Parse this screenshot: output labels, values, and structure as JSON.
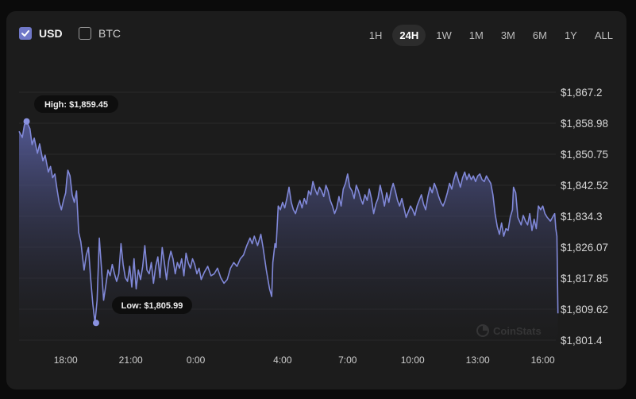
{
  "currency": {
    "usd_label": "USD",
    "btc_label": "BTC"
  },
  "ranges": [
    "1H",
    "24H",
    "1W",
    "1M",
    "3M",
    "6M",
    "1Y",
    "ALL"
  ],
  "active_range": "24H",
  "watermark": "CoinStats",
  "colors": {
    "line": "#8088d8",
    "fill_top": "#5c63a8",
    "accent": "#7078c8"
  },
  "chart_data": {
    "type": "area",
    "ylim": [
      1801.4,
      1867.2
    ],
    "y_ticks": [
      "$1,867.2",
      "$1,858.98",
      "$1,850.75",
      "$1,842.52",
      "$1,834.3",
      "$1,826.07",
      "$1,817.85",
      "$1,809.62",
      "$1,801.4"
    ],
    "x_ticks": [
      {
        "label": "18:00",
        "t": 18
      },
      {
        "label": "21:00",
        "t": 21
      },
      {
        "label": "0:00",
        "t": 24
      },
      {
        "label": "4:00",
        "t": 28
      },
      {
        "label": "7:00",
        "t": 31
      },
      {
        "label": "10:00",
        "t": 34
      },
      {
        "label": "13:00",
        "t": 37
      },
      {
        "label": "16:00",
        "t": 40
      }
    ],
    "xlim": [
      15.85,
      40.6
    ],
    "high": {
      "label": "High: $1,859.45",
      "t": 16.2,
      "value": 1859.45
    },
    "low": {
      "label": "Low: $1,805.99",
      "t": 19.4,
      "value": 1805.99
    },
    "points": [
      [
        15.85,
        1856.8
      ],
      [
        16.0,
        1855.2
      ],
      [
        16.1,
        1858.6
      ],
      [
        16.2,
        1859.45
      ],
      [
        16.35,
        1857.5
      ],
      [
        16.45,
        1853.3
      ],
      [
        16.55,
        1855.0
      ],
      [
        16.7,
        1851.0
      ],
      [
        16.8,
        1853.5
      ],
      [
        16.95,
        1849.0
      ],
      [
        17.05,
        1850.5
      ],
      [
        17.2,
        1846.0
      ],
      [
        17.3,
        1847.5
      ],
      [
        17.4,
        1844.5
      ],
      [
        17.5,
        1845.5
      ],
      [
        17.6,
        1841.5
      ],
      [
        17.7,
        1838.0
      ],
      [
        17.8,
        1836.0
      ],
      [
        17.9,
        1838.5
      ],
      [
        18.0,
        1840.5
      ],
      [
        18.05,
        1844.0
      ],
      [
        18.1,
        1846.5
      ],
      [
        18.2,
        1845.0
      ],
      [
        18.3,
        1840.0
      ],
      [
        18.4,
        1838.0
      ],
      [
        18.5,
        1841.0
      ],
      [
        18.6,
        1830.0
      ],
      [
        18.7,
        1827.5
      ],
      [
        18.85,
        1820.0
      ],
      [
        18.95,
        1824.0
      ],
      [
        19.05,
        1826.0
      ],
      [
        19.15,
        1818.0
      ],
      [
        19.25,
        1811.0
      ],
      [
        19.35,
        1805.99
      ],
      [
        19.45,
        1812.0
      ],
      [
        19.55,
        1828.5
      ],
      [
        19.65,
        1820.5
      ],
      [
        19.75,
        1812.0
      ],
      [
        19.85,
        1816.0
      ],
      [
        19.95,
        1820.0
      ],
      [
        20.05,
        1818.5
      ],
      [
        20.15,
        1821.5
      ],
      [
        20.25,
        1819.0
      ],
      [
        20.35,
        1817.0
      ],
      [
        20.45,
        1819.0
      ],
      [
        20.55,
        1827.0
      ],
      [
        20.65,
        1821.5
      ],
      [
        20.75,
        1818.0
      ],
      [
        20.85,
        1817.0
      ],
      [
        20.95,
        1821.0
      ],
      [
        21.05,
        1815.5
      ],
      [
        21.15,
        1823.0
      ],
      [
        21.25,
        1815.0
      ],
      [
        21.35,
        1820.0
      ],
      [
        21.45,
        1817.5
      ],
      [
        21.55,
        1821.0
      ],
      [
        21.65,
        1826.5
      ],
      [
        21.75,
        1820.0
      ],
      [
        21.85,
        1819.0
      ],
      [
        21.95,
        1822.0
      ],
      [
        22.05,
        1816.5
      ],
      [
        22.15,
        1821.0
      ],
      [
        22.25,
        1823.5
      ],
      [
        22.35,
        1818.0
      ],
      [
        22.45,
        1826.0
      ],
      [
        22.55,
        1822.0
      ],
      [
        22.65,
        1817.5
      ],
      [
        22.75,
        1822.5
      ],
      [
        22.85,
        1825.0
      ],
      [
        22.95,
        1823.0
      ],
      [
        23.05,
        1819.0
      ],
      [
        23.15,
        1822.0
      ],
      [
        23.25,
        1820.5
      ],
      [
        23.35,
        1823.0
      ],
      [
        23.45,
        1818.5
      ],
      [
        23.55,
        1824.5
      ],
      [
        23.65,
        1822.0
      ],
      [
        23.75,
        1820.5
      ],
      [
        23.85,
        1823.0
      ],
      [
        23.95,
        1821.5
      ],
      [
        24.05,
        1819.0
      ],
      [
        24.15,
        1820.5
      ],
      [
        24.25,
        1817.5
      ],
      [
        24.4,
        1819.5
      ],
      [
        24.55,
        1821.0
      ],
      [
        24.7,
        1818.5
      ],
      [
        24.85,
        1819.0
      ],
      [
        25.0,
        1820.5
      ],
      [
        25.15,
        1818.0
      ],
      [
        25.3,
        1816.5
      ],
      [
        25.45,
        1817.5
      ],
      [
        25.6,
        1820.5
      ],
      [
        25.75,
        1822.0
      ],
      [
        25.9,
        1821.0
      ],
      [
        26.05,
        1823.0
      ],
      [
        26.2,
        1824.0
      ],
      [
        26.35,
        1826.5
      ],
      [
        26.5,
        1828.5
      ],
      [
        26.6,
        1827.0
      ],
      [
        26.7,
        1829.0
      ],
      [
        26.85,
        1826.5
      ],
      [
        27.0,
        1829.5
      ],
      [
        27.1,
        1826.0
      ],
      [
        27.25,
        1820.0
      ],
      [
        27.4,
        1815.0
      ],
      [
        27.5,
        1813.0
      ],
      [
        27.55,
        1822.0
      ],
      [
        27.65,
        1827.0
      ],
      [
        27.7,
        1826.0
      ],
      [
        27.8,
        1837.0
      ],
      [
        27.9,
        1836.0
      ],
      [
        28.0,
        1838.0
      ],
      [
        28.1,
        1836.5
      ],
      [
        28.2,
        1839.0
      ],
      [
        28.3,
        1842.0
      ],
      [
        28.4,
        1838.0
      ],
      [
        28.5,
        1836.0
      ],
      [
        28.6,
        1835.0
      ],
      [
        28.7,
        1837.0
      ],
      [
        28.8,
        1838.5
      ],
      [
        28.9,
        1836.5
      ],
      [
        29.0,
        1839.0
      ],
      [
        29.1,
        1837.5
      ],
      [
        29.2,
        1841.0
      ],
      [
        29.3,
        1840.0
      ],
      [
        29.4,
        1843.5
      ],
      [
        29.5,
        1841.5
      ],
      [
        29.6,
        1840.0
      ],
      [
        29.7,
        1842.0
      ],
      [
        29.8,
        1841.0
      ],
      [
        29.9,
        1839.5
      ],
      [
        30.0,
        1842.5
      ],
      [
        30.1,
        1841.0
      ],
      [
        30.2,
        1838.5
      ],
      [
        30.3,
        1837.0
      ],
      [
        30.4,
        1835.0
      ],
      [
        30.5,
        1836.5
      ],
      [
        30.6,
        1839.5
      ],
      [
        30.7,
        1837.0
      ],
      [
        30.8,
        1841.5
      ],
      [
        30.9,
        1843.0
      ],
      [
        31.0,
        1845.5
      ],
      [
        31.1,
        1842.0
      ],
      [
        31.2,
        1841.0
      ],
      [
        31.3,
        1839.0
      ],
      [
        31.4,
        1842.5
      ],
      [
        31.5,
        1841.0
      ],
      [
        31.6,
        1839.0
      ],
      [
        31.7,
        1837.5
      ],
      [
        31.8,
        1840.0
      ],
      [
        31.9,
        1838.5
      ],
      [
        32.0,
        1841.5
      ],
      [
        32.1,
        1839.0
      ],
      [
        32.2,
        1835.0
      ],
      [
        32.3,
        1837.5
      ],
      [
        32.4,
        1839.0
      ],
      [
        32.5,
        1842.5
      ],
      [
        32.6,
        1840.0
      ],
      [
        32.7,
        1837.0
      ],
      [
        32.8,
        1840.5
      ],
      [
        32.9,
        1838.0
      ],
      [
        33.0,
        1841.0
      ],
      [
        33.1,
        1843.0
      ],
      [
        33.2,
        1841.0
      ],
      [
        33.3,
        1838.5
      ],
      [
        33.4,
        1837.0
      ],
      [
        33.5,
        1839.0
      ],
      [
        33.6,
        1836.5
      ],
      [
        33.7,
        1834.0
      ],
      [
        33.8,
        1835.5
      ],
      [
        33.9,
        1837.0
      ],
      [
        34.0,
        1836.0
      ],
      [
        34.1,
        1834.5
      ],
      [
        34.2,
        1837.0
      ],
      [
        34.3,
        1838.5
      ],
      [
        34.4,
        1840.0
      ],
      [
        34.5,
        1837.5
      ],
      [
        34.6,
        1836.0
      ],
      [
        34.7,
        1839.5
      ],
      [
        34.8,
        1842.0
      ],
      [
        34.9,
        1840.5
      ],
      [
        35.0,
        1843.0
      ],
      [
        35.1,
        1841.5
      ],
      [
        35.2,
        1839.5
      ],
      [
        35.3,
        1838.0
      ],
      [
        35.4,
        1837.0
      ],
      [
        35.5,
        1838.5
      ],
      [
        35.6,
        1840.5
      ],
      [
        35.7,
        1843.0
      ],
      [
        35.8,
        1841.5
      ],
      [
        35.9,
        1844.0
      ],
      [
        36.0,
        1846.0
      ],
      [
        36.1,
        1844.0
      ],
      [
        36.2,
        1842.0
      ],
      [
        36.3,
        1844.5
      ],
      [
        36.4,
        1846.0
      ],
      [
        36.5,
        1844.0
      ],
      [
        36.6,
        1845.5
      ],
      [
        36.7,
        1844.0
      ],
      [
        36.8,
        1845.0
      ],
      [
        36.9,
        1843.5
      ],
      [
        37.0,
        1845.0
      ],
      [
        37.1,
        1845.5
      ],
      [
        37.2,
        1844.0
      ],
      [
        37.3,
        1843.5
      ],
      [
        37.4,
        1845.0
      ],
      [
        37.5,
        1844.0
      ],
      [
        37.6,
        1843.0
      ],
      [
        37.7,
        1840.0
      ],
      [
        37.8,
        1835.0
      ],
      [
        37.9,
        1831.5
      ],
      [
        38.0,
        1829.5
      ],
      [
        38.1,
        1832.5
      ],
      [
        38.2,
        1829.0
      ],
      [
        38.3,
        1831.0
      ],
      [
        38.4,
        1830.5
      ],
      [
        38.5,
        1834.0
      ],
      [
        38.6,
        1836.0
      ],
      [
        38.65,
        1842.0
      ],
      [
        38.75,
        1840.5
      ],
      [
        38.85,
        1834.0
      ],
      [
        39.0,
        1832.0
      ],
      [
        39.1,
        1834.5
      ],
      [
        39.2,
        1833.0
      ],
      [
        39.3,
        1832.0
      ],
      [
        39.4,
        1835.0
      ],
      [
        39.5,
        1830.5
      ],
      [
        39.6,
        1833.5
      ],
      [
        39.7,
        1831.0
      ],
      [
        39.8,
        1837.0
      ],
      [
        39.9,
        1836.0
      ],
      [
        40.0,
        1837.0
      ],
      [
        40.1,
        1835.0
      ],
      [
        40.2,
        1834.0
      ],
      [
        40.35,
        1833.0
      ],
      [
        40.45,
        1834.0
      ],
      [
        40.55,
        1835.0
      ],
      [
        40.6,
        1831.0
      ],
      [
        40.65,
        1829.0
      ],
      [
        40.7,
        1808.5
      ]
    ]
  }
}
